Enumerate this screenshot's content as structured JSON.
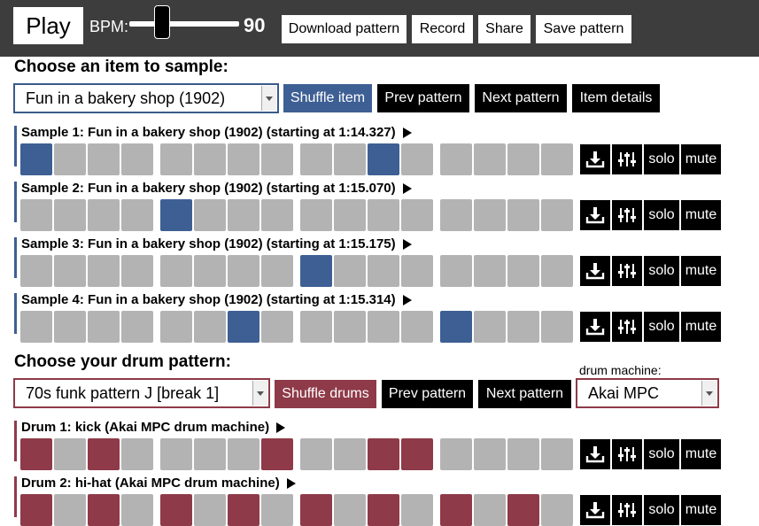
{
  "topbar": {
    "play_label": "Play",
    "bpm_label": "BPM:",
    "bpm_value": "90",
    "buttons": [
      "Download pattern",
      "Record",
      "Share",
      "Save pattern"
    ]
  },
  "item_section": {
    "heading": "Choose an item to sample:",
    "selected_item": "Fun in a bakery shop (1902)",
    "buttons": [
      "Shuffle item",
      "Prev pattern",
      "Next pattern",
      "Item details"
    ]
  },
  "samples": [
    {
      "label": "Sample 1: Fun in a bakery shop (1902) (starting at 1:14.327)",
      "active_steps": [
        0,
        10
      ]
    },
    {
      "label": "Sample 2: Fun in a bakery shop (1902) (starting at 1:15.070)",
      "active_steps": [
        4
      ]
    },
    {
      "label": "Sample 3: Fun in a bakery shop (1902) (starting at 1:15.175)",
      "active_steps": [
        8
      ]
    },
    {
      "label": "Sample 4: Fun in a bakery shop (1902) (starting at 1:15.314)",
      "active_steps": [
        6,
        12
      ]
    }
  ],
  "drum_section": {
    "heading": "Choose your drum pattern:",
    "selected_pattern": "70s funk pattern J [break 1]",
    "buttons": [
      "Shuffle drums",
      "Prev pattern",
      "Next pattern"
    ],
    "machine_label": "drum machine:",
    "selected_machine": "Akai MPC"
  },
  "drums": [
    {
      "label": "Drum 1: kick (Akai MPC drum machine)",
      "active_steps": [
        0,
        2,
        7,
        10,
        11
      ]
    },
    {
      "label": "Drum 2: hi-hat (Akai MPC drum machine)",
      "active_steps": [
        0,
        2,
        4,
        6,
        8,
        10,
        12,
        14
      ]
    }
  ],
  "row_controls": {
    "solo": "solo",
    "mute": "mute"
  },
  "colors": {
    "accent_blue": "#3d5f94",
    "accent_red": "#8e3a48",
    "step_off": "#b3b3b3",
    "topbar": "#3d3d3d"
  }
}
